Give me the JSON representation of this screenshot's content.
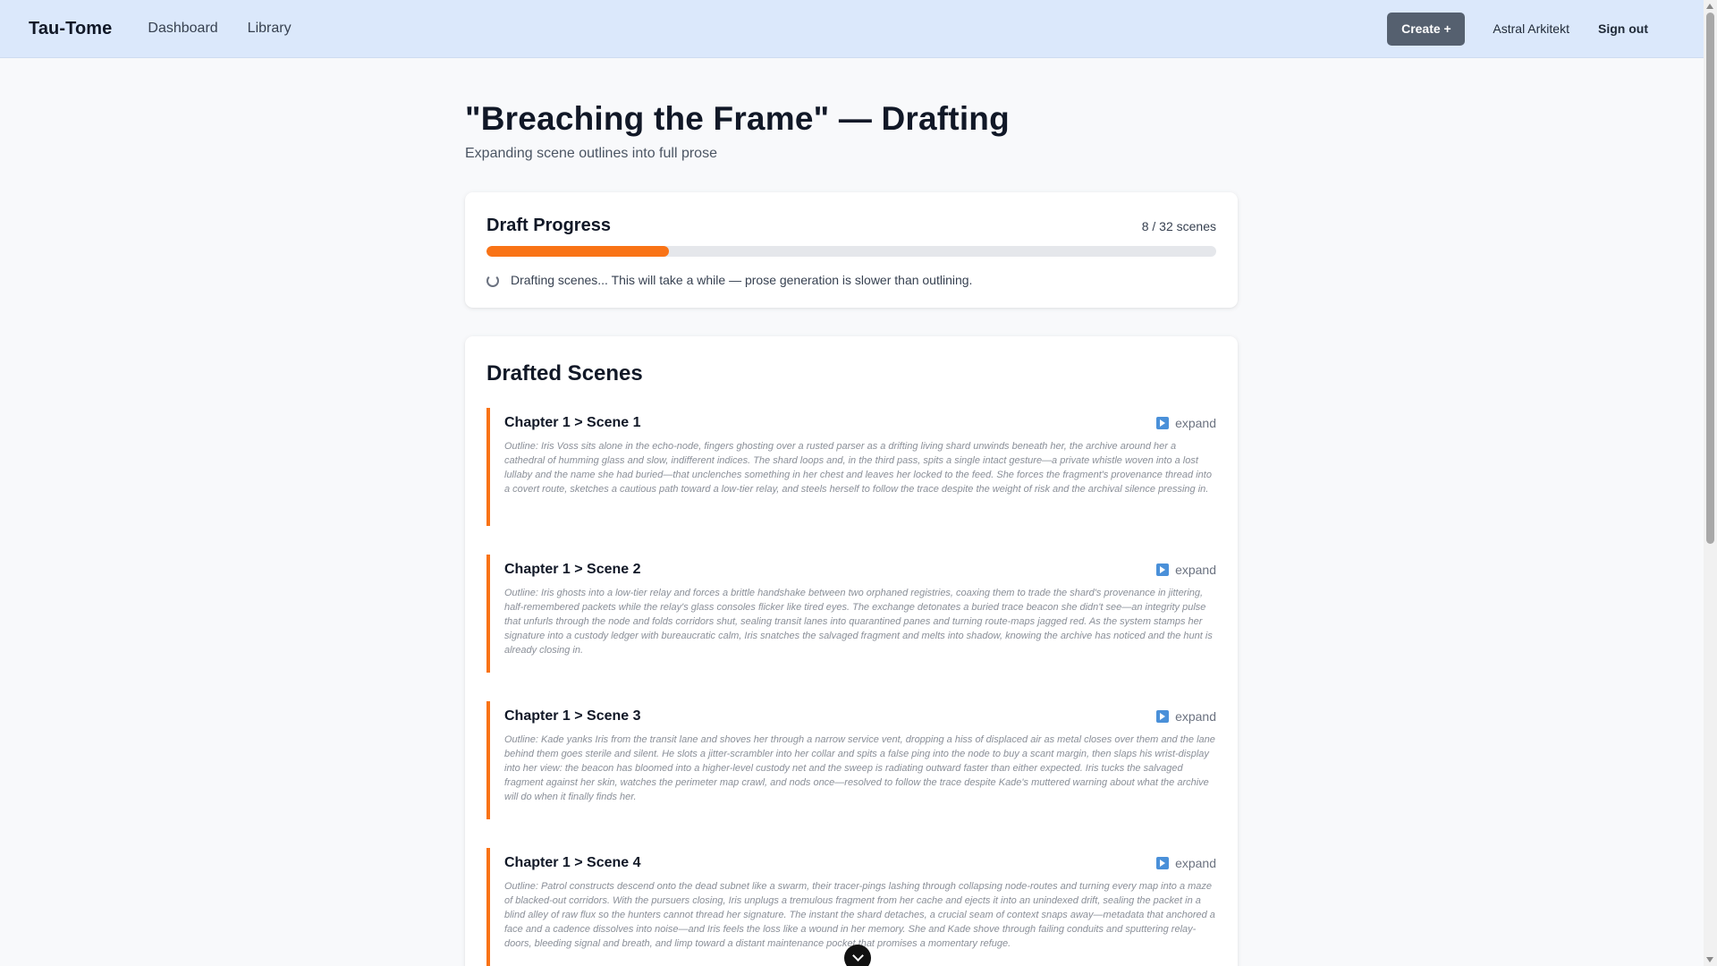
{
  "nav": {
    "brand": "Tau-Tome",
    "links": [
      "Dashboard",
      "Library"
    ],
    "create_label": "Create +",
    "user_name": "Astral Arkitekt",
    "signout_label": "Sign out"
  },
  "page": {
    "title": "\"Breaching the Frame\" — Drafting",
    "subtitle": "Expanding scene outlines into full prose"
  },
  "progress": {
    "title": "Draft Progress",
    "count": "8 / 32 scenes",
    "fraction": 0.25,
    "status": "Drafting scenes... This will take a while — prose generation is slower than outlining.",
    "fill_color": "#f97316"
  },
  "scenes": {
    "title": "Drafted Scenes",
    "expand_label": "expand",
    "items": [
      {
        "title": "Chapter 1 > Scene 1",
        "outline": "Outline: Iris Voss sits alone in the echo-node, fingers ghosting over a rusted parser as a drifting living shard unwinds beneath her, the archive around her a cathedral of humming glass and slow, indifferent indices. The shard loops and, in the third pass, spits a single intact gesture—a private whistle woven into a lost lullaby and the name she had buried—that unclenches something in her chest and leaves her locked to the feed. She forces the fragment's provenance thread into a covert route, sketches a cautious path toward a low-tier relay, and steels herself to follow the trace despite the weight of risk and the archival silence pressing in."
      },
      {
        "title": "Chapter 1 > Scene 2",
        "outline": "Outline: Iris ghosts into a low-tier relay and forces a brittle handshake between two orphaned registries, coaxing them to trade the shard's provenance in jittering, half-remembered packets while the relay's glass consoles flicker like tired eyes. The exchange detonates a buried trace beacon she didn't see—an integrity pulse that unfurls through the node and folds corridors shut, sealing transit lanes into quarantined panes and turning route-maps jagged red. As the system stamps her signature into a custody ledger with bureaucratic calm, Iris snatches the salvaged fragment and melts into shadow, knowing the archive has noticed and the hunt is already closing in."
      },
      {
        "title": "Chapter 1 > Scene 3",
        "outline": "Outline: Kade yanks Iris from the transit lane and shoves her through a narrow service vent, dropping a hiss of displaced air as metal closes over them and the lane behind them goes sterile and silent. He slots a jitter-scrambler into her collar and spits a false ping into the node to buy a scant margin, then slaps his wrist-display into her view: the beacon has bloomed into a higher-level custody net and the sweep is radiating outward faster than either expected. Iris tucks the salvaged fragment against her skin, watches the perimeter map crawl, and nods once—resolved to follow the trace despite Kade's muttered warning about what the archive will do when it finally finds her."
      },
      {
        "title": "Chapter 1 > Scene 4",
        "outline": "Outline: Patrol constructs descend onto the dead subnet like a swarm, their tracer-pings lashing through collapsing node-routes and turning every map into a maze of blacked-out corridors. With the pursuers closing, Iris unplugs a tremulous fragment from her cache and ejects it into an unindexed drift, sealing the packet in a blind alley of raw flux so the hunters cannot thread her signature. The instant the shard detaches, a crucial seam of context snaps away—metadata that anchored a face and a cadence dissolves into noise—and Iris feels the loss like a wound in her memory. She and Kade shove through failing conduits and sputtering relay-doors, bleeding signal and breath, and limp toward a distant maintenance pocket that promises a momentary refuge."
      }
    ]
  }
}
